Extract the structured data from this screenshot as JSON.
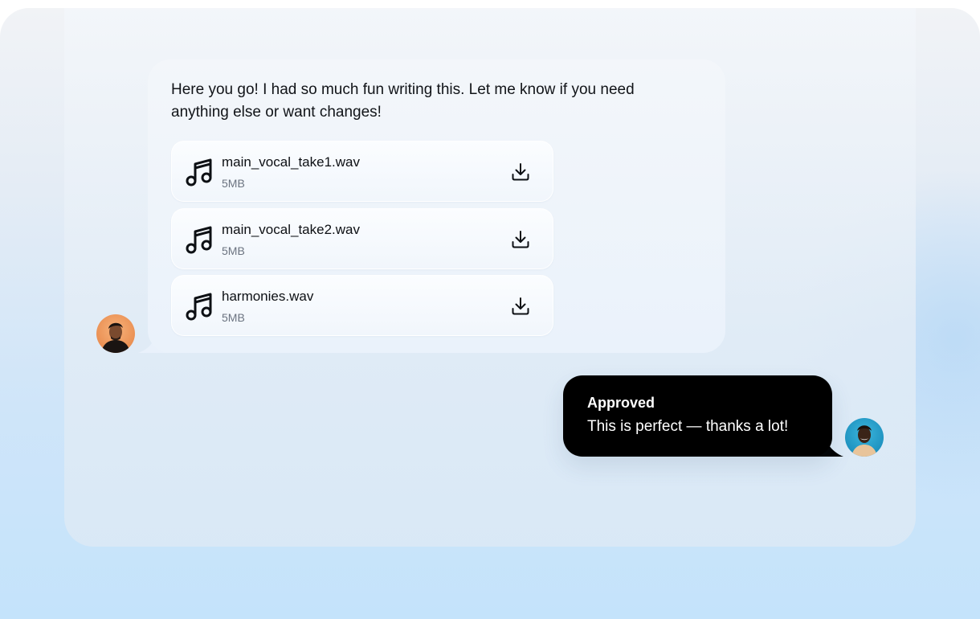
{
  "incoming_message": {
    "text": "Here you go! I had so much fun writing this. Let me know if you need anything else or want changes!",
    "attachments": [
      {
        "name": "main_vocal_take1.wav",
        "size": "5MB",
        "icon": "music-note-icon"
      },
      {
        "name": "main_vocal_take2.wav",
        "size": "5MB",
        "icon": "music-note-icon"
      },
      {
        "name": "harmonies.wav",
        "size": "5MB",
        "icon": "music-note-icon"
      }
    ]
  },
  "outgoing_message": {
    "title": "Approved",
    "text": "This is perfect — thanks a lot!"
  },
  "colors": {
    "outgoing_bubble": "#000000",
    "incoming_bubble": "#eef3fa",
    "left_avatar_bg": "#f4a36a",
    "right_avatar_bg": "#2aa4cf"
  }
}
